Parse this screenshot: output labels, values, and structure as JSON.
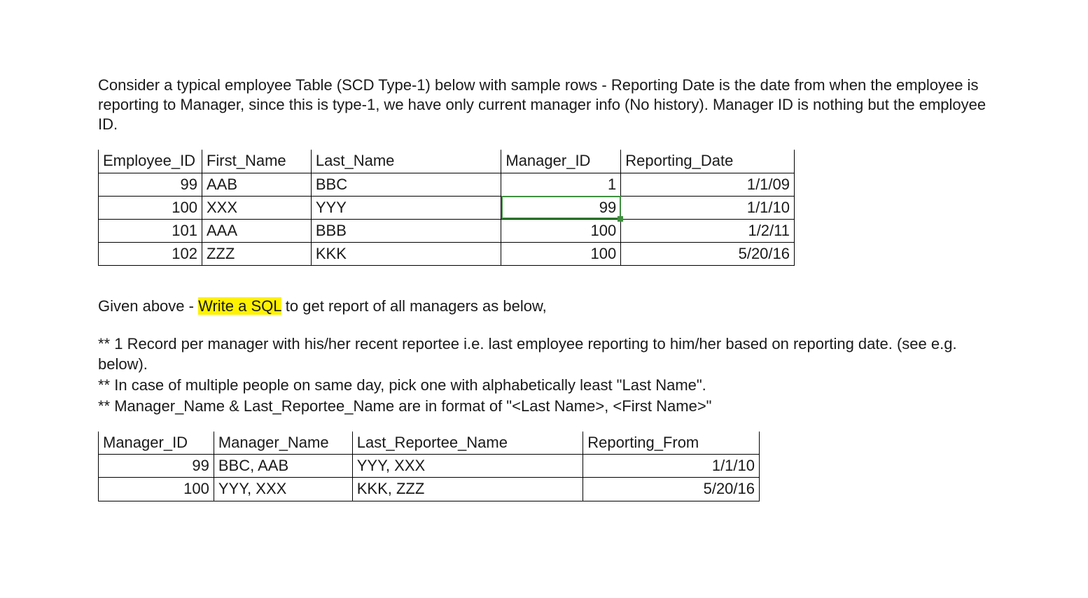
{
  "intro": {
    "p1": "Consider a typical employee Table (SCD Type-1) below with sample rows - Reporting Date is the date from when the employee is reporting to Manager, since this is type-1, we have only current manager info (No history). Manager ID is nothing but the employee ID."
  },
  "employee_table": {
    "headers": [
      "Employee_ID",
      "First_Name",
      "Last_Name",
      "Manager_ID",
      "Reporting_Date"
    ],
    "rows": [
      {
        "eid": "99",
        "fn": "AAB",
        "ln": "BBC",
        "mid": "1",
        "rd": "1/1/09"
      },
      {
        "eid": "100",
        "fn": "XXX",
        "ln": "YYY",
        "mid": "99",
        "rd": "1/1/10"
      },
      {
        "eid": "101",
        "fn": "AAA",
        "ln": "BBB",
        "mid": "100",
        "rd": "1/2/11"
      },
      {
        "eid": "102",
        "fn": "ZZZ",
        "ln": "KKK",
        "mid": "100",
        "rd": "5/20/16"
      }
    ]
  },
  "task": {
    "prefix": "Given above - ",
    "highlight": "Write a SQL",
    "suffix": " to get report of all managers as below,"
  },
  "rules": {
    "r1": "** 1 Record per manager with his/her recent reportee i.e. last employee reporting to him/her based on reporting date. (see e.g. below).",
    "r2": "** In case of multiple people on same day, pick one with alphabetically least \"Last Name\".",
    "r3": "** Manager_Name & Last_Reportee_Name are in format of \"<Last Name>, <First Name>\""
  },
  "manager_table": {
    "headers": [
      "Manager_ID",
      "Manager_Name",
      "Last_Reportee_Name",
      "Reporting_From"
    ],
    "rows": [
      {
        "mid": "99",
        "mname": "BBC, AAB",
        "rname": "YYY, XXX",
        "rf": "1/1/10"
      },
      {
        "mid": "100",
        "mname": "YYY, XXX",
        "rname": "KKK, ZZZ",
        "rf": "5/20/16"
      }
    ]
  }
}
